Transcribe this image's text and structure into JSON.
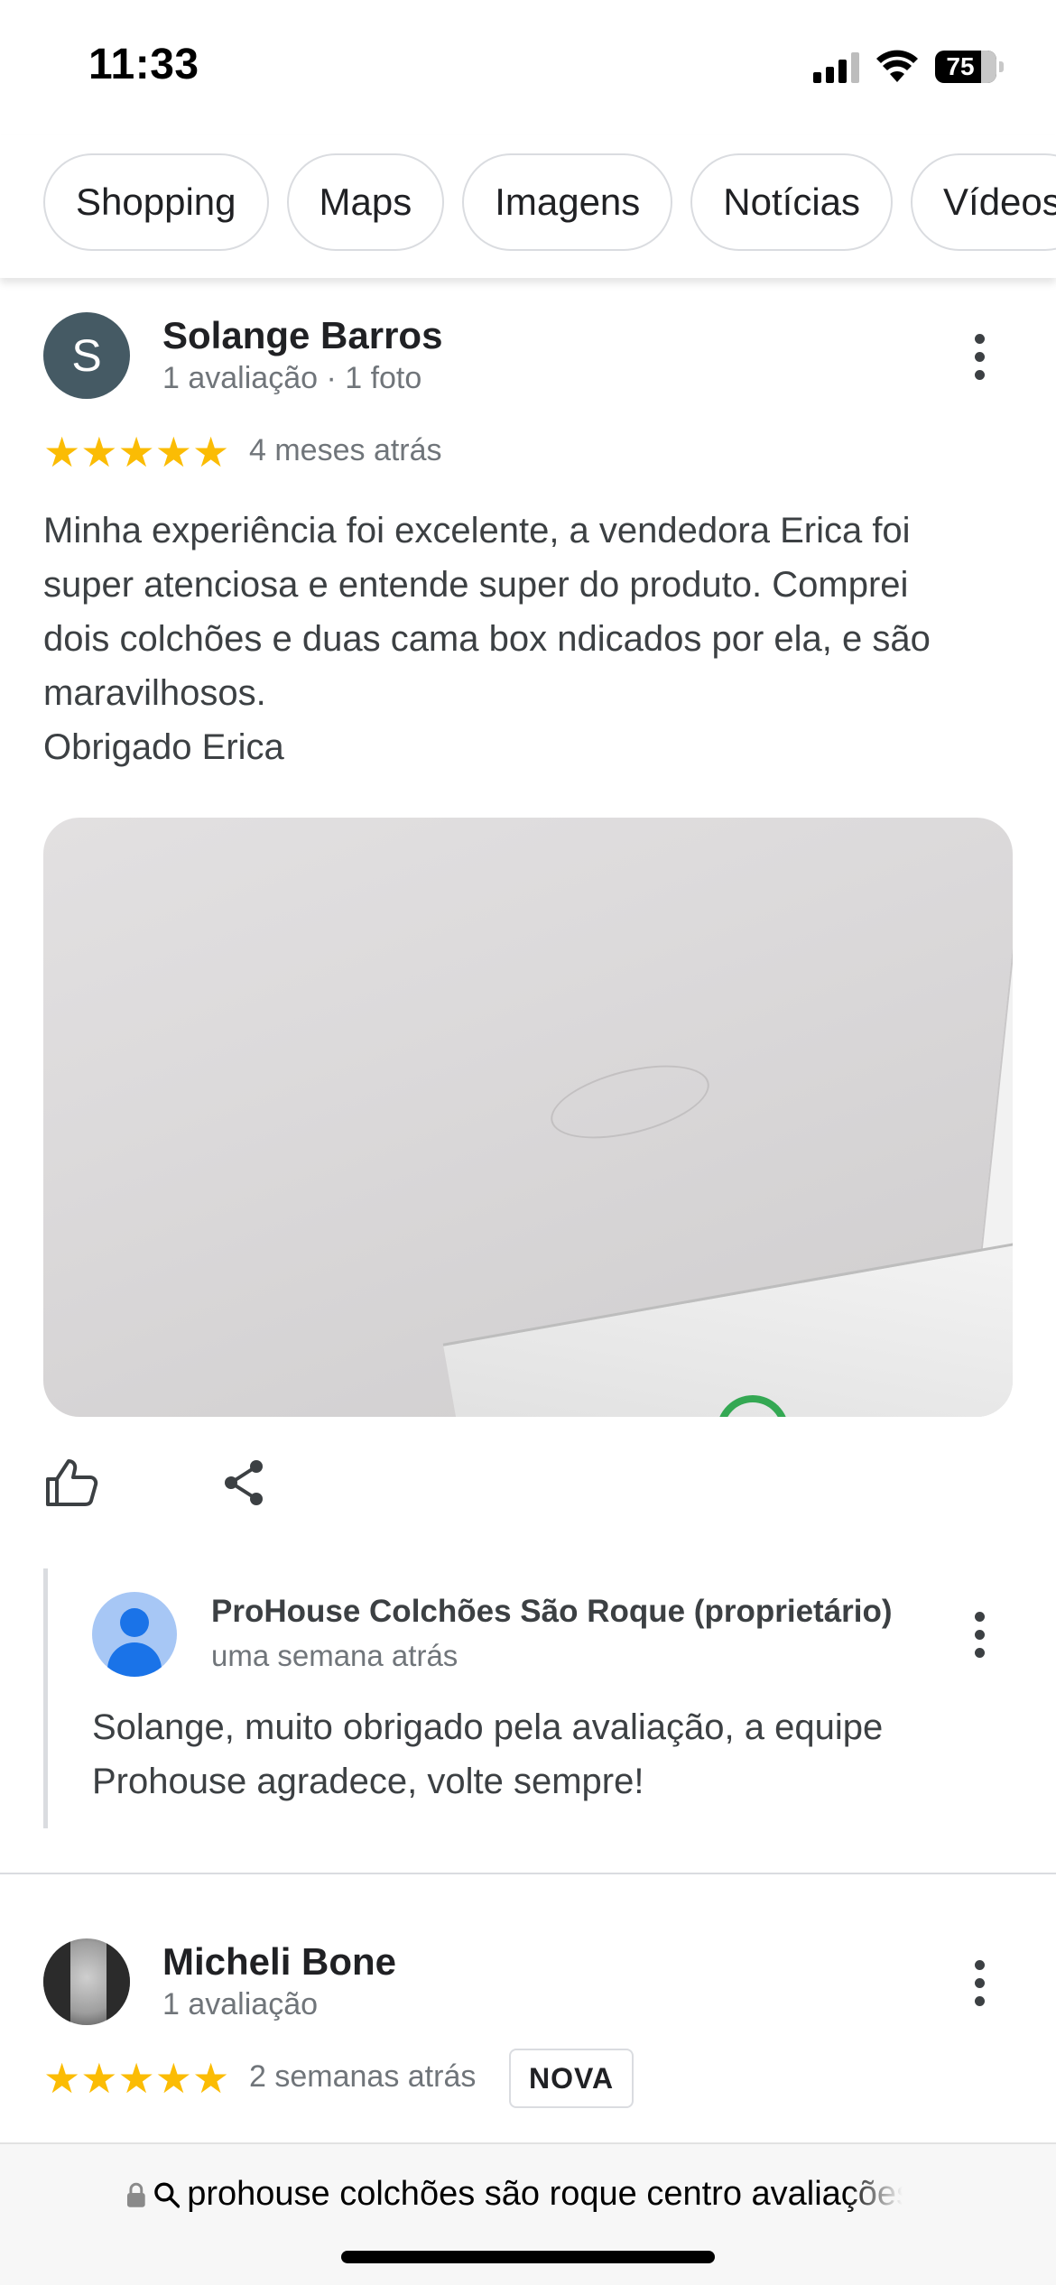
{
  "status_bar": {
    "time": "11:33",
    "battery": "75"
  },
  "filters": [
    "Shopping",
    "Maps",
    "Imagens",
    "Notícias",
    "Vídeos"
  ],
  "reviews": [
    {
      "avatar_letter": "S",
      "name": "Solange Barros",
      "meta": "1 avaliação · 1 foto",
      "rating": 5,
      "stars": "★★★★★",
      "time": "4 meses atrás",
      "text_lines": [
        "Minha experiência foi excelente, a vendedora Erica foi",
        "super atenciosa e entende super do produto. Comprei",
        "dois colchões e duas cama box ndicados por ela, e são",
        "maravilhosos.",
        "Obrigado Erica"
      ],
      "owner_reply": {
        "name": "ProHouse Colchões São Roque (proprietário)",
        "time": "uma semana atrás",
        "text_lines": [
          "Solange, muito obrigado pela avaliação, a equipe",
          "Prohouse agradece, volte sempre!"
        ]
      }
    },
    {
      "name": "Micheli Bone",
      "meta": "1 avaliação",
      "rating": 5,
      "stars": "★★★★★",
      "time": "2 semanas atrás",
      "badge": "NOVA"
    }
  ],
  "address_bar": {
    "query": "prohouse colchões são roque centro avaliações"
  },
  "colors": {
    "star": "#fbbc04",
    "avatar_bg": "#455a64",
    "accent_blue": "#1a73e8"
  },
  "icons": [
    "cellular-signal-icon",
    "wifi-icon",
    "battery-icon",
    "more-vert-icon",
    "thumbs-up-icon",
    "share-icon",
    "lock-icon",
    "search-icon"
  ]
}
